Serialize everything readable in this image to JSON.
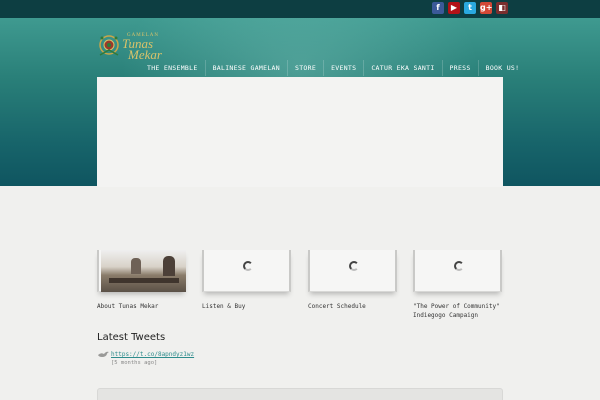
{
  "social": [
    {
      "icon": "facebook-icon",
      "glyph": "f",
      "color": "#3b5998"
    },
    {
      "icon": "youtube-icon",
      "glyph": "▶",
      "color": "#b31217"
    },
    {
      "icon": "twitter-icon",
      "glyph": "t",
      "color": "#2aa9e0"
    },
    {
      "icon": "googleplus-icon",
      "glyph": "g+",
      "color": "#d34836"
    },
    {
      "icon": "rss-icon",
      "glyph": "◧",
      "color": "#7a2e2e"
    }
  ],
  "logo": {
    "small_text": "GAMELAN",
    "name_line1": "Tunas",
    "name_line2": "Mekar"
  },
  "nav": [
    "THE ENSEMBLE",
    "BALINESE GAMELAN",
    "STORE",
    "EVENTS",
    "CATUR EKA SANTI",
    "PRESS",
    "BOOK US!"
  ],
  "thumbs": [
    {
      "caption": "About Tunas Mekar",
      "loaded": true
    },
    {
      "caption": "Listen & Buy",
      "loaded": false
    },
    {
      "caption": "Concert Schedule",
      "loaded": false
    },
    {
      "caption": "\"The Power of Community\" Indiegogo Campaign",
      "loaded": false
    }
  ],
  "tweets": {
    "title": "Latest Tweets",
    "items": [
      {
        "link": "https://t.co/8apndyz1wz",
        "time": "[5 months ago]"
      }
    ]
  },
  "colors": {
    "topbar": "#0d3e42",
    "hero_top": "#3f9a90",
    "hero_bottom": "#0f5560",
    "link": "#2e8c8c"
  }
}
